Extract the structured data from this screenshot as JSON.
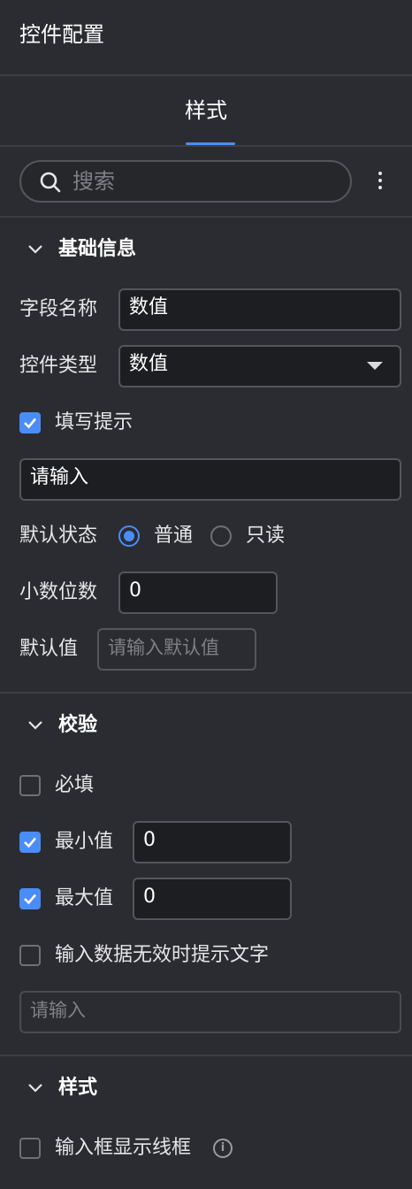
{
  "header": {
    "title": "控件配置"
  },
  "tabs": [
    {
      "label": "样式",
      "active": true
    }
  ],
  "colors": {
    "accent": "#4a8df8",
    "background": "#2b2c31",
    "field_bg": "#1d1e22"
  },
  "search": {
    "placeholder": "搜索"
  },
  "basic_info": {
    "title": "基础信息",
    "field_name": {
      "label": "字段名称",
      "value": "数值"
    },
    "control_type": {
      "label": "控件类型",
      "value": "数值"
    },
    "hint": {
      "label": "填写提示",
      "checked": true,
      "value": "请输入"
    },
    "default_state": {
      "label": "默认状态",
      "options": [
        "普通",
        "只读"
      ],
      "selected": "普通"
    },
    "decimals": {
      "label": "小数位数",
      "value": "0"
    },
    "default_value": {
      "label": "默认值",
      "placeholder": "请输入默认值"
    }
  },
  "validation": {
    "title": "校验",
    "required": {
      "label": "必填",
      "checked": false
    },
    "min": {
      "label": "最小值",
      "checked": true,
      "value": "0"
    },
    "max": {
      "label": "最大值",
      "checked": true,
      "value": "0"
    },
    "invalid_hint": {
      "label": "输入数据无效时提示文字",
      "checked": false,
      "placeholder": "请输入"
    }
  },
  "style": {
    "title": "样式",
    "show_border": {
      "label": "输入框显示线框",
      "checked": false
    }
  }
}
